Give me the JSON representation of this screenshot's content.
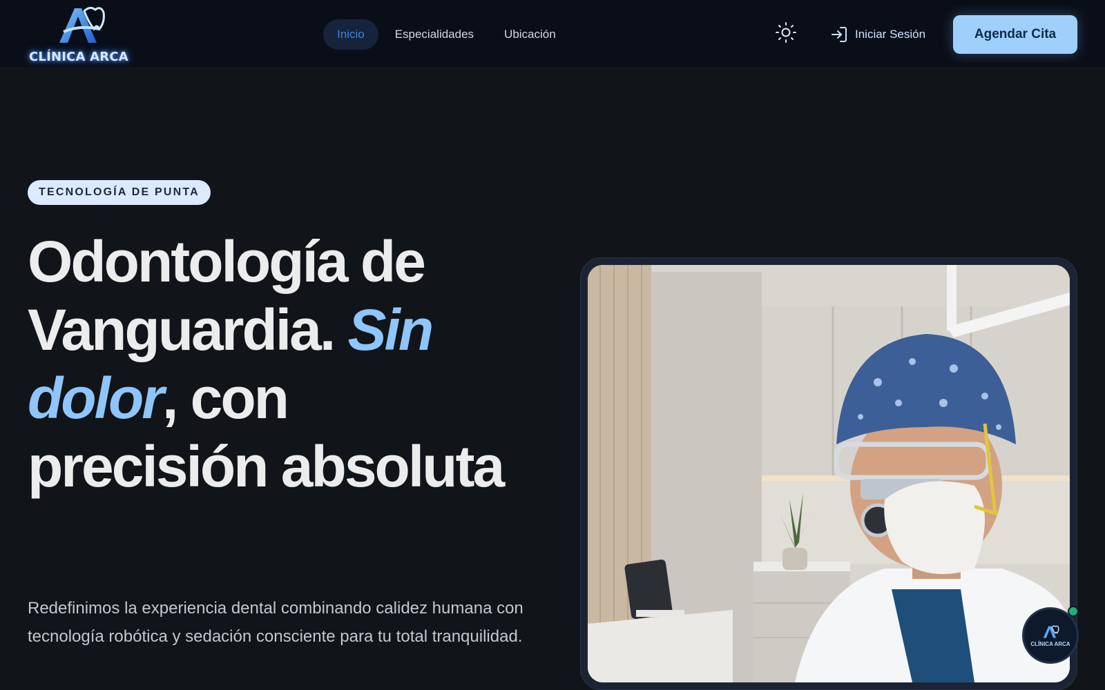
{
  "brand": {
    "name": "CLÍNICA ARCA",
    "logo_icon": "arca-tooth-logo",
    "glow_color": "#4f9dff"
  },
  "nav": {
    "items": [
      {
        "label": "Inicio",
        "active": true
      },
      {
        "label": "Especialidades",
        "active": false
      },
      {
        "label": "Ubicación",
        "active": false
      }
    ]
  },
  "header_actions": {
    "theme_icon": "sun-icon",
    "login_icon": "login-arrow-icon",
    "login_label": "Iniciar Sesión",
    "cta_label": "Agendar Cita",
    "cta_color": "#9fd0fb"
  },
  "hero": {
    "badge": "TECNOLOGÍA DE PUNTA",
    "headline_part1": "Odontología de Vanguardia. ",
    "headline_highlight": "Sin dolor",
    "headline_part2": ", con precisión absoluta",
    "highlight_color": "#8ec5fb",
    "description": "Redefinimos la experiencia dental combinando calidez humana con tecnología robótica y sedación consciente para tu total tranquilidad."
  },
  "photo": {
    "subject": "dentist-with-loupes-photo",
    "mini_badge_text": "CLÍNICA ARCA",
    "online_status_color": "#1bb272"
  }
}
